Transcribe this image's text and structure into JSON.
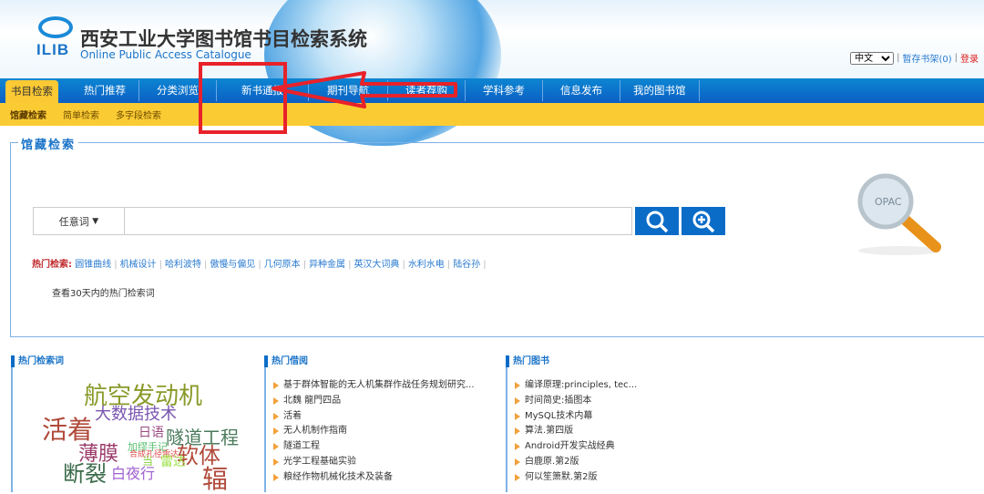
{
  "header": {
    "logo_text": "ILIB",
    "title": "西安工业大学图书馆书目检索系统",
    "subtitle": "Online Public Access Catalogue",
    "language": "中文",
    "shelf": "暂存书架(0)",
    "login": "登录"
  },
  "nav": {
    "tabs": [
      "书目检索",
      "热门推荐",
      "分类浏览",
      "新书通报",
      "期刊导航",
      "读者荐购",
      "学科参考",
      "信息发布",
      "我的图书馆"
    ],
    "sub_tabs": [
      "馆藏检索",
      "简单检索",
      "多字段检索"
    ]
  },
  "search": {
    "legend": "馆藏检索",
    "field": "任意词",
    "query": "",
    "hot_label": "热门检索:",
    "hot_terms": [
      "圆锥曲线",
      "机械设计",
      "哈利波特",
      "傲慢与偏见",
      "几何原本",
      "异种金属",
      "英汉大词典",
      "水利水电",
      "陆谷孙"
    ],
    "view_30_days": "查看30天内的热门检索词",
    "opac_text": "OPAC"
  },
  "hot_words": {
    "title": "热门检索词",
    "words": [
      {
        "text": "航空发动机",
        "color": "#8a9a2a"
      },
      {
        "text": "大数据技术",
        "color": "#7a55b0"
      },
      {
        "text": "活着",
        "color": "#b04a3a"
      },
      {
        "text": "日语",
        "color": "#9a4a80"
      },
      {
        "text": "隧道工程",
        "color": "#4a7a5a"
      },
      {
        "text": "加缪手记",
        "color": "#5ac070"
      },
      {
        "text": "合成孔径雷达",
        "color": "#e04a4a"
      },
      {
        "text": "薄膜",
        "color": "#9a3a6a"
      },
      {
        "text": "软体",
        "color": "#b04a3a"
      },
      {
        "text": "当",
        "color": "#8ad040"
      },
      {
        "text": "雷达",
        "color": "#9ae040"
      },
      {
        "text": "断裂",
        "color": "#3a6a4a"
      },
      {
        "text": "白夜行",
        "color": "#a060d0"
      },
      {
        "text": "辐",
        "color": "#b04a3a"
      }
    ]
  },
  "hot_borrow": {
    "title": "热门借阅",
    "items": [
      "基于群体智能的无人机集群作战任务规划研究...",
      "北魏 龍門四品",
      "活着",
      "无人机制作指南",
      "隧道工程",
      "光学工程基础实验",
      "粮经作物机械化技术及装备"
    ]
  },
  "hot_books": {
    "title": "热门图书",
    "items": [
      "编译原理:principles, tec...",
      "时间简史:插图本",
      "MySQL技术内幕",
      "算法.第四版",
      "Android开发实战经典",
      "白鹿原.第2版",
      "何以笙箫默.第2版"
    ]
  },
  "colors": {
    "nav_blue": "#0b6cc8",
    "sub_yellow": "#fbcb34",
    "annotation_red": "#e8222a"
  }
}
